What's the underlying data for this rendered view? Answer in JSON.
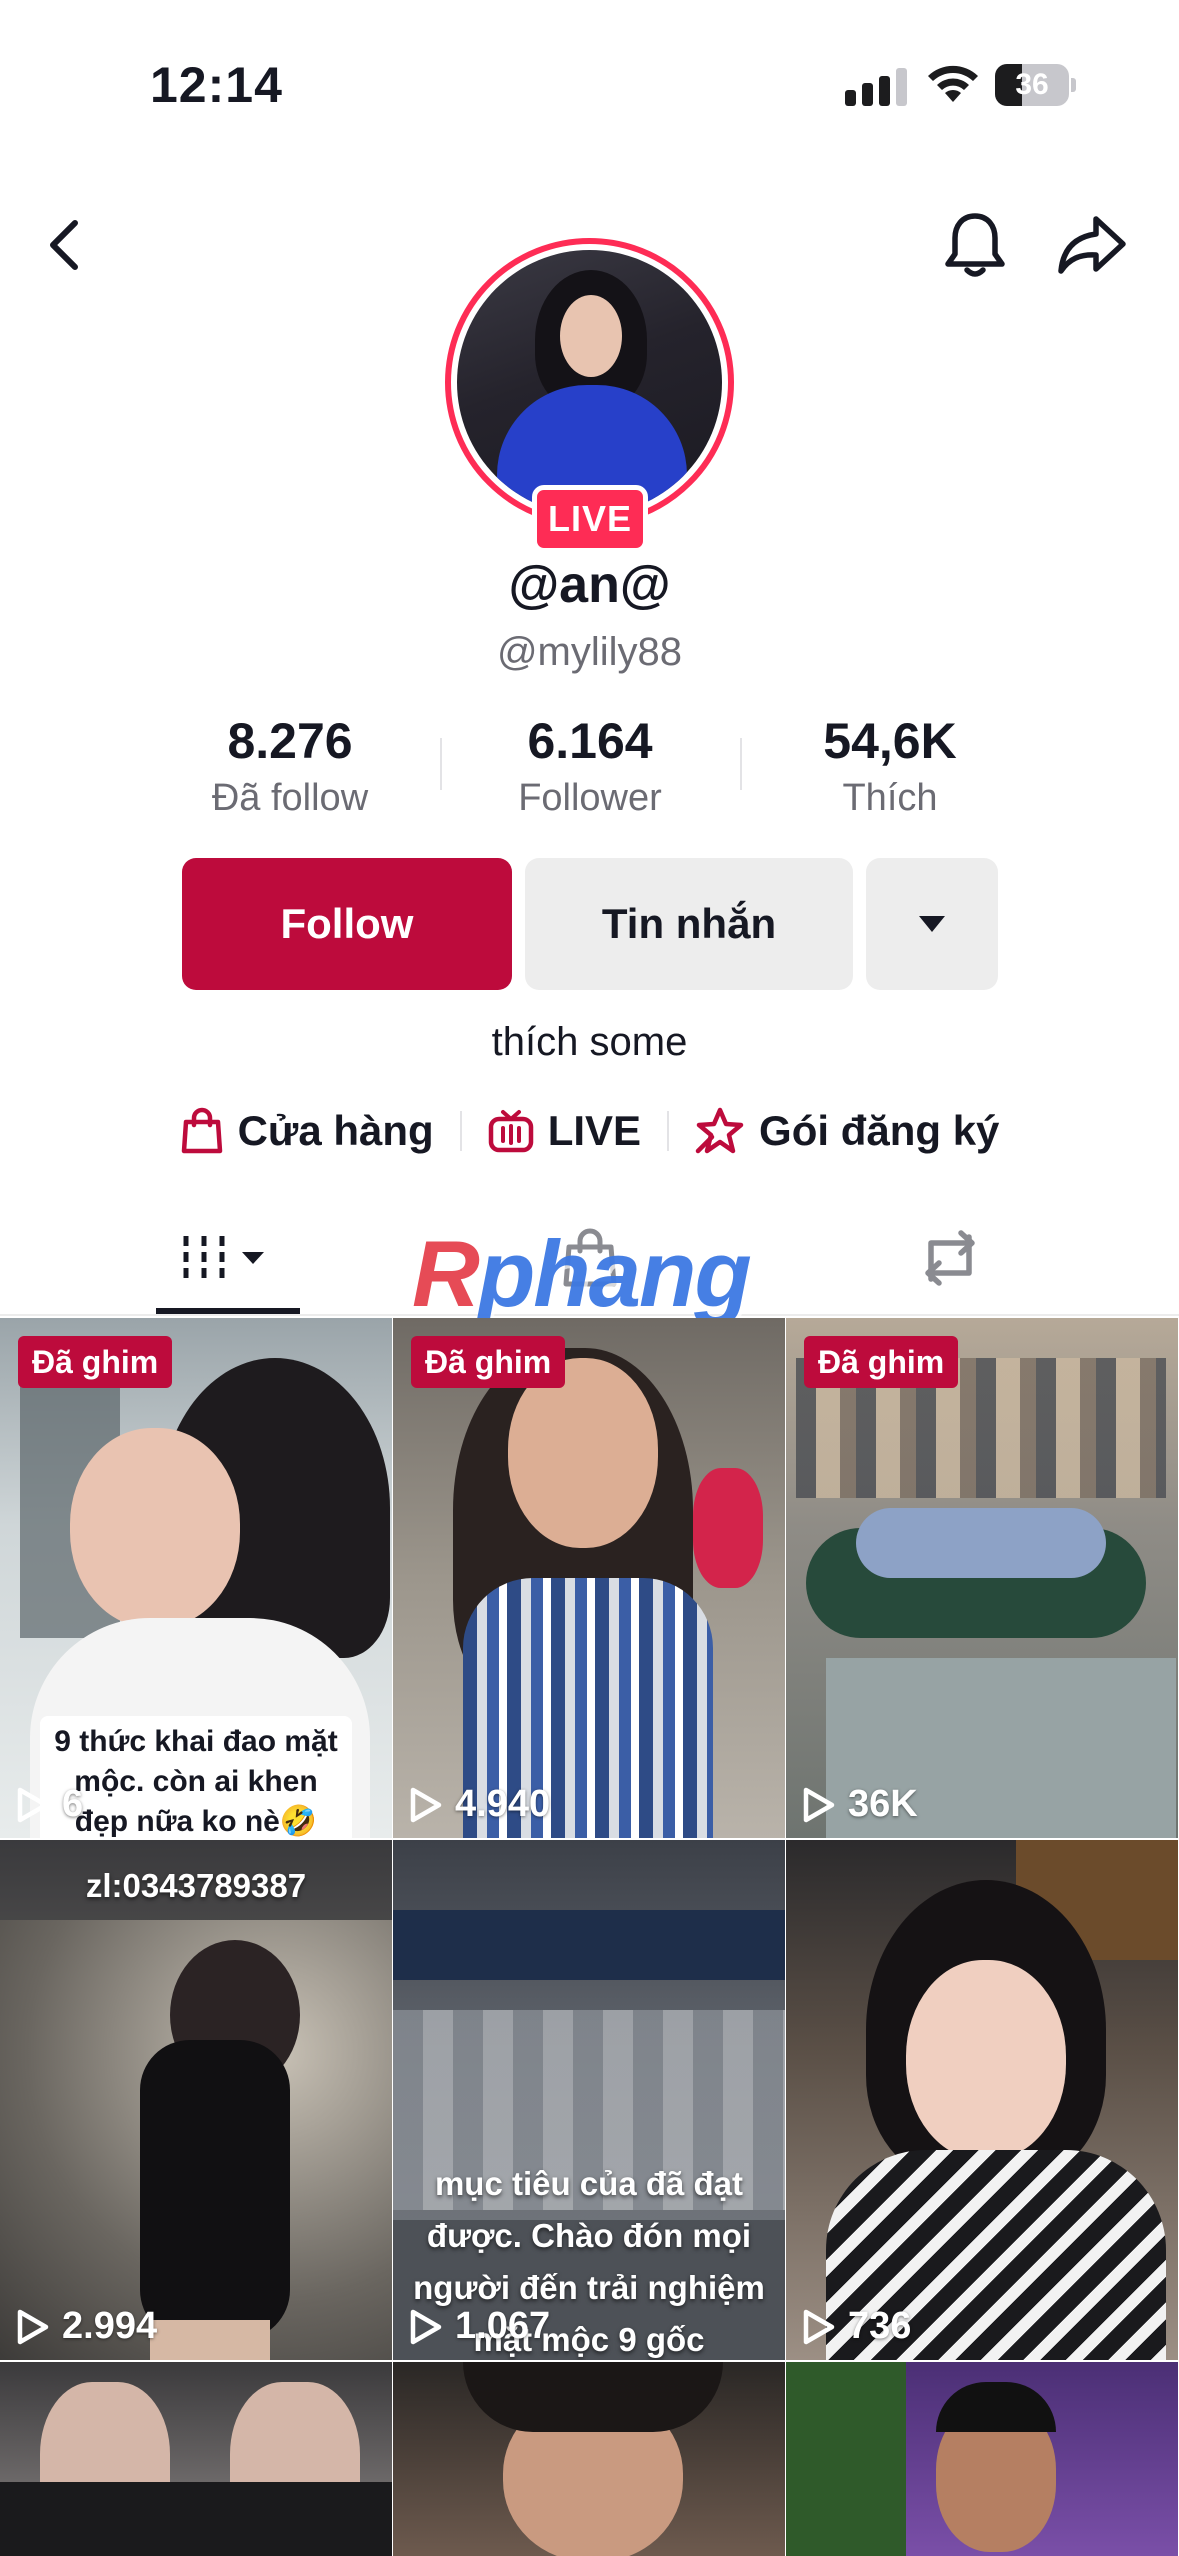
{
  "status_bar": {
    "time": "12:14",
    "battery": "36",
    "battery_level_percent": 36
  },
  "header": {
    "back_icon": "chevron-left-icon",
    "bell_icon": "bell-icon",
    "share_icon": "share-arrow-icon"
  },
  "profile": {
    "live_badge": "LIVE",
    "display_name": "@an@",
    "username": "@mylily88",
    "stats": [
      {
        "value": "8.276",
        "label": "Đã follow"
      },
      {
        "value": "6.164",
        "label": "Follower"
      },
      {
        "value": "54,6K",
        "label": "Thích"
      }
    ],
    "buttons": {
      "follow": "Follow",
      "message": "Tin nhắn",
      "more_icon": "caret-down-icon"
    },
    "bio": "thích some",
    "links": [
      {
        "icon": "shopping-bag-icon",
        "label": "Cửa hàng"
      },
      {
        "icon": "live-tv-icon",
        "label": "LIVE"
      },
      {
        "icon": "subscription-star-icon",
        "label": "Gói đăng ký"
      }
    ]
  },
  "tabs": [
    {
      "name": "videos",
      "icon": "grid-bars-icon"
    },
    {
      "name": "shop",
      "icon": "shop-bag-icon"
    },
    {
      "name": "reposts",
      "icon": "repost-icon"
    }
  ],
  "watermark": {
    "first": "R",
    "rest": "phang"
  },
  "videos": [
    {
      "pinned": "Đã ghim",
      "views": "6",
      "caption": "9 thức khai đao mặt\nmộc. còn ai khen\nđẹp nữa ko nè🤣"
    },
    {
      "pinned": "Đã ghim",
      "views": "4.940"
    },
    {
      "pinned": "Đã ghim",
      "views": "36K"
    },
    {
      "views": "2.994",
      "caption": "zl:0343789387"
    },
    {
      "views": "1.067",
      "caption": "mục tiêu của đã đạt\nđược. Chào đón mọi\nngười đến trải nghiệm\nmặt mộc 9 gốc"
    },
    {
      "views": "736"
    }
  ],
  "colors": {
    "brand_red": "#bd0b3c",
    "live_pink": "#fe2c55",
    "watermark_blue": "#3d79e3"
  }
}
